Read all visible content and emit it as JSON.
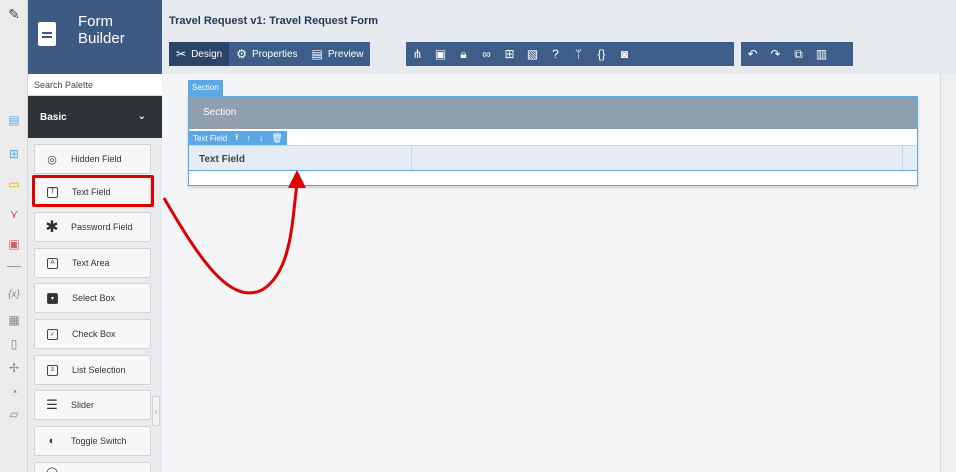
{
  "header": {
    "builder_title": "Form Builder",
    "form_title": "Travel Request v1: Travel Request Form"
  },
  "toolbar": {
    "design_label": "Design",
    "properties_label": "Properties",
    "preview_label": "Preview"
  },
  "palette": {
    "search_placeholder": "Search Palette",
    "category": "Basic",
    "items": [
      {
        "label": "Hidden Field",
        "icon": "eye-slash-icon"
      },
      {
        "label": "Text Field",
        "icon": "text-field-icon"
      },
      {
        "label": "Password Field",
        "icon": "asterisk-icon"
      },
      {
        "label": "Text Area",
        "icon": "text-area-icon"
      },
      {
        "label": "Select Box",
        "icon": "select-box-icon"
      },
      {
        "label": "Check Box",
        "icon": "checkbox-icon"
      },
      {
        "label": "List Selection",
        "icon": "list-icon"
      },
      {
        "label": "Slider",
        "icon": "slider-icon"
      },
      {
        "label": "Toggle Switch",
        "icon": "toggle-icon"
      }
    ]
  },
  "canvas": {
    "section_tag": "Section",
    "section_title": "Section",
    "field_toolbar_label": "Text Field",
    "field_label": "Text Field"
  },
  "colors": {
    "accent": "#5aa9e6",
    "header_bg": "#3c5a84",
    "highlight": "#e10000"
  }
}
